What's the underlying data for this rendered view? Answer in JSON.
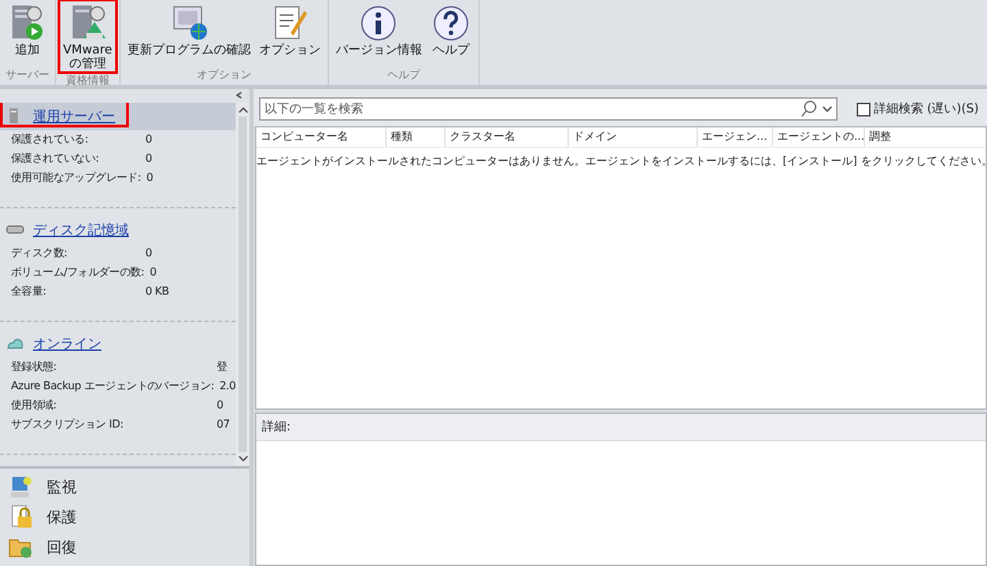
{
  "ribbon": {
    "groups": [
      {
        "label": "サーバー",
        "buttons": [
          {
            "label": "追加",
            "highlighted": false
          }
        ]
      },
      {
        "label": "資格情報",
        "buttons": [
          {
            "label": "VMware\nの管理",
            "highlighted": true
          }
        ]
      },
      {
        "label": "オプション",
        "buttons": [
          {
            "label": "更新プログラムの確認",
            "highlighted": false
          },
          {
            "label": "オプション",
            "highlighted": false
          }
        ]
      },
      {
        "label": "ヘルプ",
        "buttons": [
          {
            "label": "バージョン情報",
            "highlighted": false
          },
          {
            "label": "ヘルプ",
            "highlighted": false
          }
        ]
      }
    ]
  },
  "sidebar": {
    "sections": [
      {
        "title": "運用サーバー",
        "selected": true,
        "highlighted": true,
        "rows": [
          {
            "label": "保護されている:",
            "value": "0"
          },
          {
            "label": "保護されていない:",
            "value": "0"
          },
          {
            "label": "使用可能なアップグレード:",
            "value": "0"
          }
        ]
      },
      {
        "title": "ディスク記憶域",
        "selected": false,
        "highlighted": false,
        "rows": [
          {
            "label": "ディスク数:",
            "value": "0"
          },
          {
            "label": "ボリューム/フォルダーの数:",
            "value": "0"
          },
          {
            "label": "全容量:",
            "value": "0 KB"
          }
        ]
      },
      {
        "title": "オンライン",
        "selected": false,
        "highlighted": false,
        "rows": [
          {
            "label": "登録状態:",
            "value": "登"
          },
          {
            "label": "Azure Backup エージェントのバージョン:",
            "value": "2.0"
          },
          {
            "label": "使用領域:",
            "value": "0"
          },
          {
            "label": "サブスクリプション ID:",
            "value": "07"
          }
        ]
      }
    ],
    "nav": [
      {
        "label": "監視"
      },
      {
        "label": "保護"
      },
      {
        "label": "回復"
      }
    ]
  },
  "search": {
    "placeholder": "以下の一覧を検索",
    "advanced_label": "詳細検索 (遅い)(S)",
    "advanced_checked": false
  },
  "table": {
    "columns": [
      "コンピューター名",
      "種類",
      "クラスター名",
      "ドメイン",
      "エージェン...",
      "エージェントの...",
      "調整"
    ],
    "empty_message": "エージェントがインストールされたコンピューターはありません。エージェントをインストールするには、[インストール] をクリックしてください。"
  },
  "details": {
    "title": "詳細:"
  }
}
